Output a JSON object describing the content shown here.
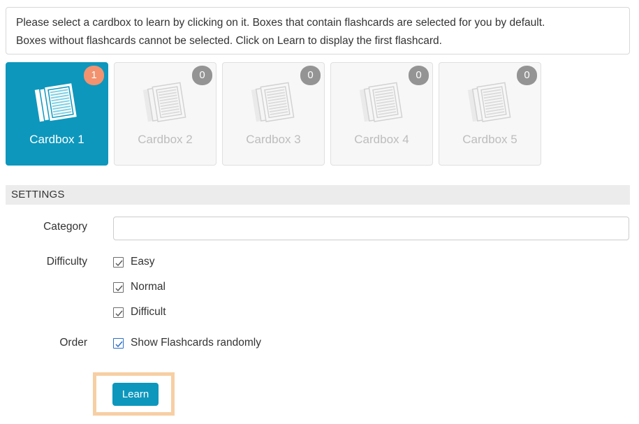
{
  "instructions": {
    "line1": "Please select a cardbox to learn by clicking on it. Boxes that contain flashcards are selected for you by default.",
    "line2": "Boxes without flashcards cannot be selected. Click on Learn to display the first flashcard."
  },
  "cardboxes": [
    {
      "label": "Cardbox 1",
      "count": "1",
      "selected": true,
      "icon": "document-stack-icon"
    },
    {
      "label": "Cardbox 2",
      "count": "0",
      "selected": false,
      "icon": "document-stack-icon"
    },
    {
      "label": "Cardbox 3",
      "count": "0",
      "selected": false,
      "icon": "document-stack-icon"
    },
    {
      "label": "Cardbox 4",
      "count": "0",
      "selected": false,
      "icon": "document-stack-icon"
    },
    {
      "label": "Cardbox 5",
      "count": "0",
      "selected": false,
      "icon": "document-stack-icon"
    }
  ],
  "settings": {
    "section_title": "SETTINGS",
    "category": {
      "label": "Category",
      "value": "",
      "placeholder": ""
    },
    "difficulty": {
      "label": "Difficulty",
      "options": [
        {
          "label": "Easy",
          "checked": true
        },
        {
          "label": "Normal",
          "checked": true
        },
        {
          "label": "Difficult",
          "checked": true
        }
      ]
    },
    "order": {
      "label": "Order",
      "option": {
        "label": "Show Flashcards randomly",
        "checked": true
      }
    }
  },
  "actions": {
    "learn_label": "Learn"
  },
  "colors": {
    "accent_teal": "#0d97bd",
    "badge_active": "#f2926e",
    "badge_inactive": "#949494",
    "highlight_ring": "#f7cfa4",
    "settings_bar": "#ececec",
    "text": "#333333",
    "muted_text": "#bdbdbd"
  }
}
